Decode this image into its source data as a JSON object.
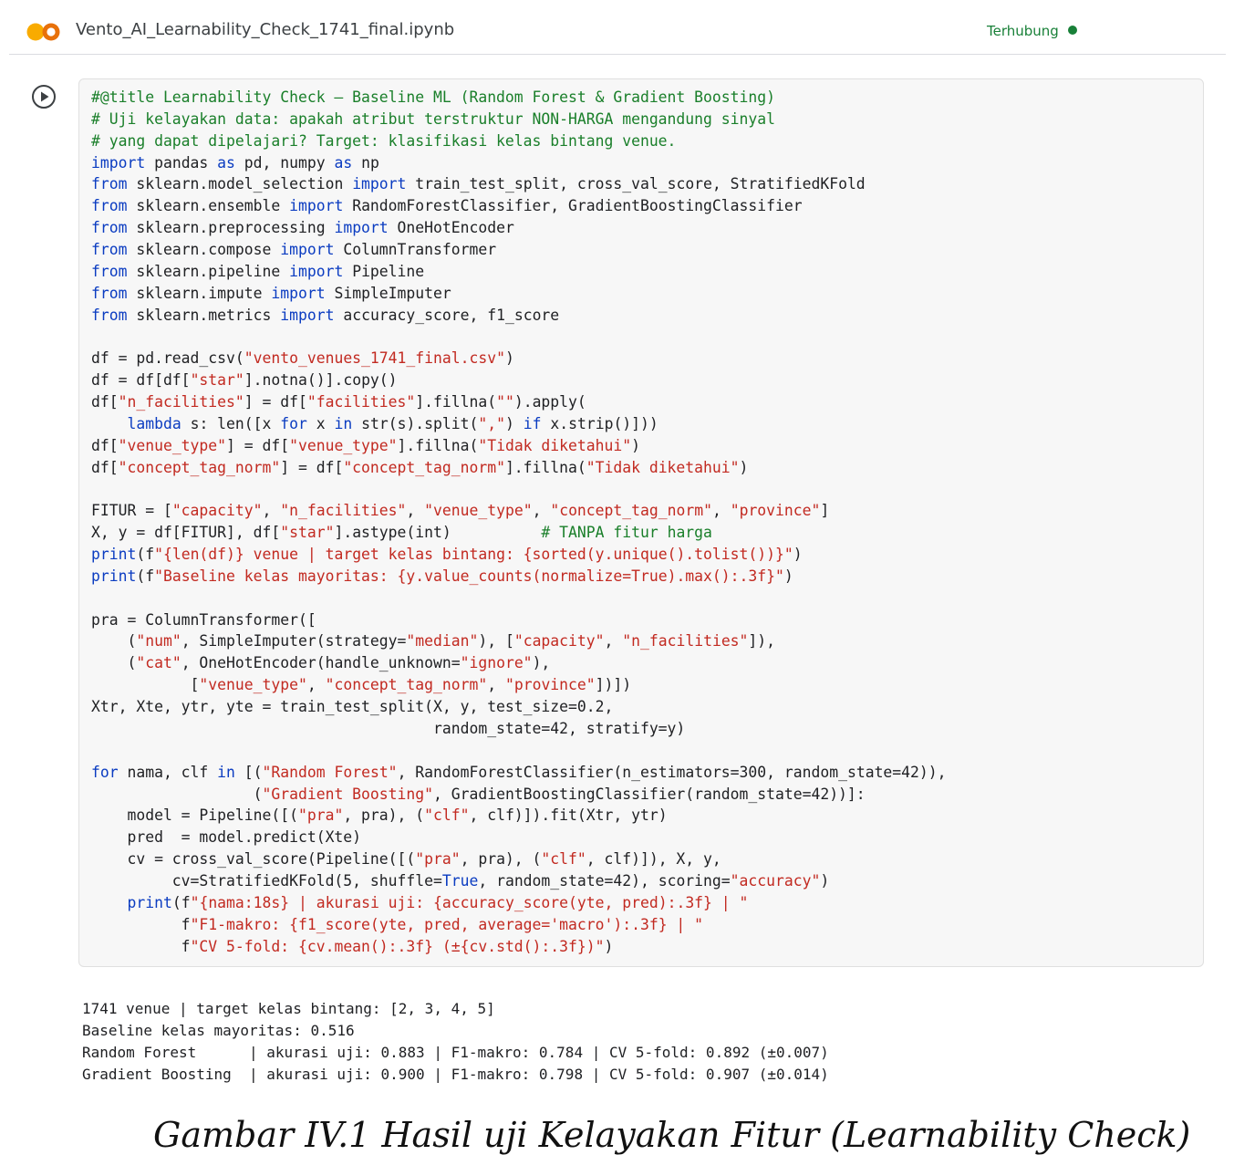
{
  "header": {
    "filename": "Vento_AI_Learnability_Check_1741_final.ipynb",
    "status": "Terhubung",
    "logo_icon": "colab-logo-icon",
    "status_color": "#188038"
  },
  "cell": {
    "run_icon": "play-circle-icon",
    "code_lines": [
      [
        {
          "t": "#@title Learnability Check — Baseline ML (Random Forest & Gradient Boosting)",
          "c": "cm"
        }
      ],
      [
        {
          "t": "# Uji kelayakan data: apakah atribut terstruktur NON-HARGA mengandung sinyal",
          "c": "cm"
        }
      ],
      [
        {
          "t": "# yang dapat dipelajari? Target: klasifikasi kelas bintang venue.",
          "c": "cm"
        }
      ],
      [
        {
          "t": "import",
          "c": "kw"
        },
        {
          "t": " pandas "
        },
        {
          "t": "as",
          "c": "kw"
        },
        {
          "t": " pd, numpy "
        },
        {
          "t": "as",
          "c": "kw"
        },
        {
          "t": " np"
        }
      ],
      [
        {
          "t": "from",
          "c": "kw"
        },
        {
          "t": " sklearn.model_selection "
        },
        {
          "t": "import",
          "c": "kw"
        },
        {
          "t": " train_test_split, cross_val_score, StratifiedKFold"
        }
      ],
      [
        {
          "t": "from",
          "c": "kw"
        },
        {
          "t": " sklearn.ensemble "
        },
        {
          "t": "import",
          "c": "kw"
        },
        {
          "t": " RandomForestClassifier, GradientBoostingClassifier"
        }
      ],
      [
        {
          "t": "from",
          "c": "kw"
        },
        {
          "t": " sklearn.preprocessing "
        },
        {
          "t": "import",
          "c": "kw"
        },
        {
          "t": " OneHotEncoder"
        }
      ],
      [
        {
          "t": "from",
          "c": "kw"
        },
        {
          "t": " sklearn.compose "
        },
        {
          "t": "import",
          "c": "kw"
        },
        {
          "t": " ColumnTransformer"
        }
      ],
      [
        {
          "t": "from",
          "c": "kw"
        },
        {
          "t": " sklearn.pipeline "
        },
        {
          "t": "import",
          "c": "kw"
        },
        {
          "t": " Pipeline"
        }
      ],
      [
        {
          "t": "from",
          "c": "kw"
        },
        {
          "t": " sklearn.impute "
        },
        {
          "t": "import",
          "c": "kw"
        },
        {
          "t": " SimpleImputer"
        }
      ],
      [
        {
          "t": "from",
          "c": "kw"
        },
        {
          "t": " sklearn.metrics "
        },
        {
          "t": "import",
          "c": "kw"
        },
        {
          "t": " accuracy_score, f1_score"
        }
      ],
      [],
      [
        {
          "t": "df = pd.read_csv("
        },
        {
          "t": "\"vento_venues_1741_final.csv\"",
          "c": "str"
        },
        {
          "t": ")"
        }
      ],
      [
        {
          "t": "df = df[df["
        },
        {
          "t": "\"star\"",
          "c": "str"
        },
        {
          "t": "].notna()].copy()"
        }
      ],
      [
        {
          "t": "df["
        },
        {
          "t": "\"n_facilities\"",
          "c": "str"
        },
        {
          "t": "] = df["
        },
        {
          "t": "\"facilities\"",
          "c": "str"
        },
        {
          "t": "].fillna("
        },
        {
          "t": "\"\"",
          "c": "str"
        },
        {
          "t": ").apply("
        }
      ],
      [
        {
          "t": "    "
        },
        {
          "t": "lambda",
          "c": "kw"
        },
        {
          "t": " s: len([x "
        },
        {
          "t": "for",
          "c": "kw"
        },
        {
          "t": " x "
        },
        {
          "t": "in",
          "c": "kw"
        },
        {
          "t": " str(s).split("
        },
        {
          "t": "\",\"",
          "c": "str"
        },
        {
          "t": ") "
        },
        {
          "t": "if",
          "c": "kw"
        },
        {
          "t": " x.strip()]))"
        }
      ],
      [
        {
          "t": "df["
        },
        {
          "t": "\"venue_type\"",
          "c": "str"
        },
        {
          "t": "] = df["
        },
        {
          "t": "\"venue_type\"",
          "c": "str"
        },
        {
          "t": "].fillna("
        },
        {
          "t": "\"Tidak diketahui\"",
          "c": "str"
        },
        {
          "t": ")"
        }
      ],
      [
        {
          "t": "df["
        },
        {
          "t": "\"concept_tag_norm\"",
          "c": "str"
        },
        {
          "t": "] = df["
        },
        {
          "t": "\"concept_tag_norm\"",
          "c": "str"
        },
        {
          "t": "].fillna("
        },
        {
          "t": "\"Tidak diketahui\"",
          "c": "str"
        },
        {
          "t": ")"
        }
      ],
      [],
      [
        {
          "t": "FITUR = ["
        },
        {
          "t": "\"capacity\"",
          "c": "str"
        },
        {
          "t": ", "
        },
        {
          "t": "\"n_facilities\"",
          "c": "str"
        },
        {
          "t": ", "
        },
        {
          "t": "\"venue_type\"",
          "c": "str"
        },
        {
          "t": ", "
        },
        {
          "t": "\"concept_tag_norm\"",
          "c": "str"
        },
        {
          "t": ", "
        },
        {
          "t": "\"province\"",
          "c": "str"
        },
        {
          "t": "]"
        }
      ],
      [
        {
          "t": "X, y = df[FITUR], df["
        },
        {
          "t": "\"star\"",
          "c": "str"
        },
        {
          "t": "].astype(int)          "
        },
        {
          "t": "# TANPA fitur harga",
          "c": "cm"
        }
      ],
      [
        {
          "t": "print",
          "c": "kw"
        },
        {
          "t": "(f"
        },
        {
          "t": "\"{len(df)} venue | target kelas bintang: {sorted(y.unique().tolist())}\"",
          "c": "str"
        },
        {
          "t": ")"
        }
      ],
      [
        {
          "t": "print",
          "c": "kw"
        },
        {
          "t": "(f"
        },
        {
          "t": "\"Baseline kelas mayoritas: {y.value_counts(normalize=True).max():.3f}\"",
          "c": "str"
        },
        {
          "t": ")"
        }
      ],
      [],
      [
        {
          "t": "pra = ColumnTransformer(["
        }
      ],
      [
        {
          "t": "    ("
        },
        {
          "t": "\"num\"",
          "c": "str"
        },
        {
          "t": ", SimpleImputer(strategy="
        },
        {
          "t": "\"median\"",
          "c": "str"
        },
        {
          "t": "), ["
        },
        {
          "t": "\"capacity\"",
          "c": "str"
        },
        {
          "t": ", "
        },
        {
          "t": "\"n_facilities\"",
          "c": "str"
        },
        {
          "t": "]),"
        }
      ],
      [
        {
          "t": "    ("
        },
        {
          "t": "\"cat\"",
          "c": "str"
        },
        {
          "t": ", OneHotEncoder(handle_unknown="
        },
        {
          "t": "\"ignore\"",
          "c": "str"
        },
        {
          "t": "),"
        }
      ],
      [
        {
          "t": "           ["
        },
        {
          "t": "\"venue_type\"",
          "c": "str"
        },
        {
          "t": ", "
        },
        {
          "t": "\"concept_tag_norm\"",
          "c": "str"
        },
        {
          "t": ", "
        },
        {
          "t": "\"province\"",
          "c": "str"
        },
        {
          "t": "])])"
        }
      ],
      [
        {
          "t": "Xtr, Xte, ytr, yte = train_test_split(X, y, test_size=0.2,"
        }
      ],
      [
        {
          "t": "                                      random_state=42, stratify=y)"
        }
      ],
      [],
      [
        {
          "t": "for",
          "c": "kw"
        },
        {
          "t": " nama, clf "
        },
        {
          "t": "in",
          "c": "kw"
        },
        {
          "t": " [("
        },
        {
          "t": "\"Random Forest\"",
          "c": "str"
        },
        {
          "t": ", RandomForestClassifier(n_estimators=300, random_state=42)),"
        }
      ],
      [
        {
          "t": "                  ("
        },
        {
          "t": "\"Gradient Boosting\"",
          "c": "str"
        },
        {
          "t": ", GradientBoostingClassifier(random_state=42))]:"
        }
      ],
      [
        {
          "t": "    model = Pipeline([("
        },
        {
          "t": "\"pra\"",
          "c": "str"
        },
        {
          "t": ", pra), ("
        },
        {
          "t": "\"clf\"",
          "c": "str"
        },
        {
          "t": ", clf)]).fit(Xtr, ytr)"
        }
      ],
      [
        {
          "t": "    pred  = model.predict(Xte)"
        }
      ],
      [
        {
          "t": "    cv = cross_val_score(Pipeline([("
        },
        {
          "t": "\"pra\"",
          "c": "str"
        },
        {
          "t": ", pra), ("
        },
        {
          "t": "\"clf\"",
          "c": "str"
        },
        {
          "t": ", clf)]), X, y,"
        }
      ],
      [
        {
          "t": "         cv=StratifiedKFold(5, shuffle="
        },
        {
          "t": "True",
          "c": "kw"
        },
        {
          "t": ", random_state=42), scoring="
        },
        {
          "t": "\"accuracy\"",
          "c": "str"
        },
        {
          "t": ")"
        }
      ],
      [
        {
          "t": "    "
        },
        {
          "t": "print",
          "c": "kw"
        },
        {
          "t": "(f"
        },
        {
          "t": "\"{nama:18s} | akurasi uji: {accuracy_score(yte, pred):.3f} | \"",
          "c": "str"
        }
      ],
      [
        {
          "t": "          f"
        },
        {
          "t": "\"F1-makro: {f1_score(yte, pred, average='macro'):.3f} | \"",
          "c": "str"
        }
      ],
      [
        {
          "t": "          f"
        },
        {
          "t": "\"CV 5-fold: {cv.mean():.3f} (±{cv.std():.3f})\"",
          "c": "str"
        },
        {
          "t": ")"
        }
      ]
    ]
  },
  "output": {
    "lines": [
      "1741 venue | target kelas bintang: [2, 3, 4, 5]",
      "Baseline kelas mayoritas: 0.516",
      "Random Forest      | akurasi uji: 0.883 | F1-makro: 0.784 | CV 5-fold: 0.892 (±0.007)",
      "Gradient Boosting  | akurasi uji: 0.900 | F1-makro: 0.798 | CV 5-fold: 0.907 (±0.014)"
    ]
  },
  "caption": "Gambar IV.1 Hasil uji Kelayakan Fitur (Learnability Check)"
}
